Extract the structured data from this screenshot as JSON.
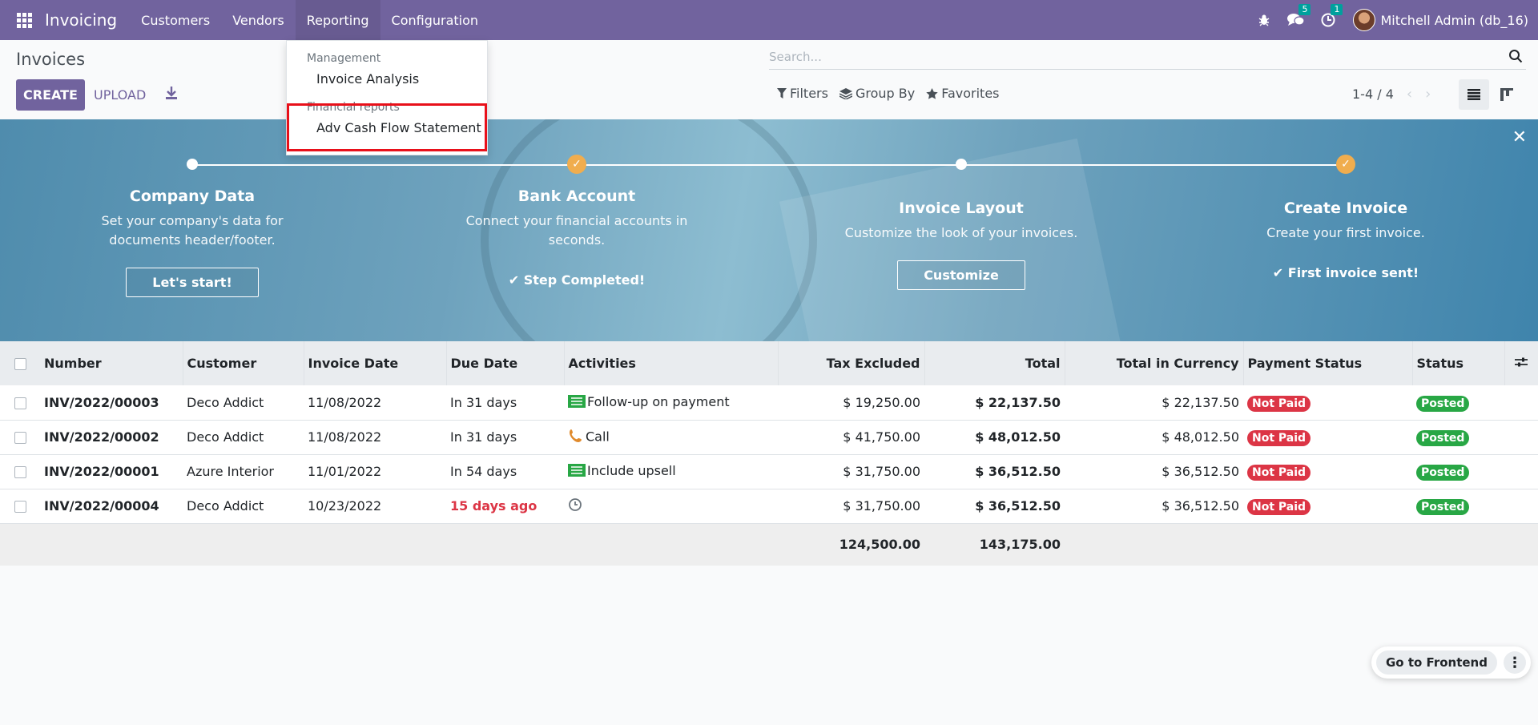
{
  "navbar": {
    "brand": "Invoicing",
    "menu": [
      "Customers",
      "Vendors",
      "Reporting",
      "Configuration"
    ],
    "messages_count": "5",
    "activities_count": "1",
    "user": "Mitchell Admin (db_16)"
  },
  "control_panel": {
    "title": "Invoices",
    "create_label": "CREATE",
    "upload_label": "UPLOAD",
    "search_placeholder": "Search...",
    "filters_label": "Filters",
    "group_by_label": "Group By",
    "favorites_label": "Favorites",
    "pager": "1-4 / 4"
  },
  "reporting_menu": {
    "section1": "Management",
    "item1": "Invoice Analysis",
    "section2": "Financial reports",
    "item2": "Adv Cash Flow Statement"
  },
  "banner": {
    "steps": [
      {
        "title": "Company Data",
        "desc": "Set your company's data for documents header/footer.",
        "action": "Let's start!",
        "done": false
      },
      {
        "title": "Bank Account",
        "desc": "Connect your financial accounts in seconds.",
        "action": "Step Completed!",
        "done": true
      },
      {
        "title": "Invoice Layout",
        "desc": "Customize the look of your invoices.",
        "action": "Customize",
        "done": false
      },
      {
        "title": "Create Invoice",
        "desc": "Create your first invoice.",
        "action": "First invoice sent!",
        "done": true
      }
    ]
  },
  "table": {
    "columns": [
      "Number",
      "Customer",
      "Invoice Date",
      "Due Date",
      "Activities",
      "Tax Excluded",
      "Total",
      "Total in Currency",
      "Payment Status",
      "Status"
    ],
    "rows": [
      {
        "number": "INV/2022/00003",
        "customer": "Deco Addict",
        "invoice_date": "11/08/2022",
        "due_date": "In 31 days",
        "activity": "Follow-up on payment",
        "activity_icon": "list-icon",
        "tax_excluded": "$ 19,250.00",
        "total": "$ 22,137.50",
        "total_currency": "$ 22,137.50",
        "payment_status": "Not Paid",
        "status": "Posted"
      },
      {
        "number": "INV/2022/00002",
        "customer": "Deco Addict",
        "invoice_date": "11/08/2022",
        "due_date": "In 31 days",
        "activity": "Call",
        "activity_icon": "phone-icon",
        "tax_excluded": "$ 41,750.00",
        "total": "$ 48,012.50",
        "total_currency": "$ 48,012.50",
        "payment_status": "Not Paid",
        "status": "Posted"
      },
      {
        "number": "INV/2022/00001",
        "customer": "Azure Interior",
        "invoice_date": "11/01/2022",
        "due_date": "In 54 days",
        "activity": "Include upsell",
        "activity_icon": "list-icon",
        "tax_excluded": "$ 31,750.00",
        "total": "$ 36,512.50",
        "total_currency": "$ 36,512.50",
        "payment_status": "Not Paid",
        "status": "Posted"
      },
      {
        "number": "INV/2022/00004",
        "customer": "Deco Addict",
        "invoice_date": "10/23/2022",
        "due_date": "15 days ago",
        "activity": "",
        "activity_icon": "clock-icon",
        "tax_excluded": "$ 31,750.00",
        "total": "$ 36,512.50",
        "total_currency": "$ 36,512.50",
        "payment_status": "Not Paid",
        "status": "Posted"
      }
    ],
    "totals": {
      "tax_excluded": "124,500.00",
      "total": "143,175.00"
    }
  },
  "frontend": {
    "label": "Go to Frontend"
  },
  "colors": {
    "brand": "#71639e",
    "danger": "#dc3545",
    "success": "#28a745",
    "warning": "#f0ad4e",
    "highlight": "#e8101a"
  }
}
